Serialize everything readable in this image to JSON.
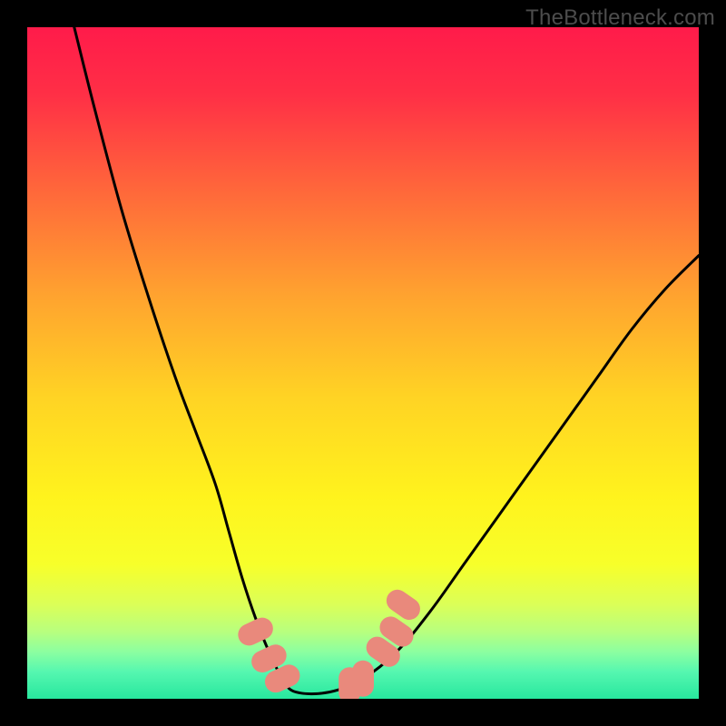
{
  "watermark": "TheBottleneck.com",
  "chart_data": {
    "type": "line",
    "title": "",
    "xlabel": "",
    "ylabel": "",
    "xlim": [
      0,
      100
    ],
    "ylim": [
      0,
      100
    ],
    "grid": false,
    "legend": false,
    "series": [
      {
        "name": "bottleneck-curve",
        "x": [
          7,
          10,
          14,
          18,
          22,
          25,
          28,
          30,
          32,
          34,
          36,
          38,
          40,
          45,
          50,
          55,
          60,
          65,
          70,
          75,
          80,
          85,
          90,
          95,
          100
        ],
        "y": [
          100,
          88,
          73,
          60,
          48,
          40,
          32,
          25,
          18,
          12,
          7,
          3,
          1,
          1,
          3,
          7,
          13,
          20,
          27,
          34,
          41,
          48,
          55,
          61,
          66
        ]
      }
    ],
    "markers": [
      {
        "name": "marker-bottom-left-1",
        "x": 34,
        "y": 10,
        "color": "#e9897c"
      },
      {
        "name": "marker-bottom-left-2",
        "x": 36,
        "y": 6,
        "color": "#e9897c"
      },
      {
        "name": "marker-bottom-left-3",
        "x": 38,
        "y": 3,
        "color": "#e9897c"
      },
      {
        "name": "marker-bottom-right-1",
        "x": 48,
        "y": 2,
        "color": "#e9897c"
      },
      {
        "name": "marker-bottom-right-2",
        "x": 50,
        "y": 3,
        "color": "#e9897c"
      },
      {
        "name": "marker-upper-right-1",
        "x": 53,
        "y": 7,
        "color": "#e9897c"
      },
      {
        "name": "marker-upper-right-2",
        "x": 55,
        "y": 10,
        "color": "#e9897c"
      },
      {
        "name": "marker-upper-right-3",
        "x": 56,
        "y": 14,
        "color": "#e9897c"
      }
    ],
    "background_gradient_stops": [
      {
        "offset": 0.0,
        "color": "#ff1b4a"
      },
      {
        "offset": 0.1,
        "color": "#ff2f46"
      },
      {
        "offset": 0.25,
        "color": "#ff6a3a"
      },
      {
        "offset": 0.4,
        "color": "#ffa32f"
      },
      {
        "offset": 0.55,
        "color": "#ffd324"
      },
      {
        "offset": 0.7,
        "color": "#fff31d"
      },
      {
        "offset": 0.8,
        "color": "#f7ff2a"
      },
      {
        "offset": 0.86,
        "color": "#dbff58"
      },
      {
        "offset": 0.9,
        "color": "#b8ff7e"
      },
      {
        "offset": 0.93,
        "color": "#8cffa0"
      },
      {
        "offset": 0.96,
        "color": "#55f7b0"
      },
      {
        "offset": 1.0,
        "color": "#28e79e"
      }
    ]
  }
}
